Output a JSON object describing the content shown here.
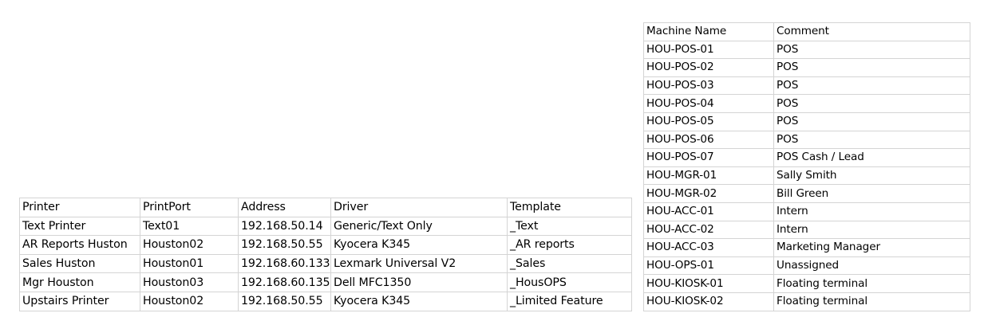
{
  "printers": {
    "headers": [
      "Printer",
      "PrintPort",
      "Address",
      "Driver",
      "Template"
    ],
    "rows": [
      [
        "Text Printer",
        "Text01",
        "192.168.50.14",
        "Generic/Text Only",
        "_Text"
      ],
      [
        "AR Reports Huston",
        "Houston02",
        "192.168.50.55",
        "Kyocera K345",
        "_AR reports"
      ],
      [
        "Sales Huston",
        "Houston01",
        "192.168.60.133",
        "Lexmark Universal V2",
        "_Sales"
      ],
      [
        "Mgr Houston",
        "Houston03",
        "192.168.60.135",
        "Dell MFC1350",
        "_HousOPS"
      ],
      [
        "Upstairs Printer",
        "Houston02",
        "192.168.50.55",
        "Kyocera K345",
        "_Limited Feature"
      ]
    ]
  },
  "machines": {
    "headers": [
      "Machine Name",
      "Comment"
    ],
    "rows": [
      [
        "HOU-POS-01",
        "POS"
      ],
      [
        "HOU-POS-02",
        "POS"
      ],
      [
        "HOU-POS-03",
        "POS"
      ],
      [
        "HOU-POS-04",
        "POS"
      ],
      [
        "HOU-POS-05",
        "POS"
      ],
      [
        "HOU-POS-06",
        "POS"
      ],
      [
        "HOU-POS-07",
        "POS Cash / Lead"
      ],
      [
        "HOU-MGR-01",
        "Sally Smith"
      ],
      [
        "HOU-MGR-02",
        "Bill Green"
      ],
      [
        "HOU-ACC-01",
        "Intern"
      ],
      [
        "HOU-ACC-02",
        "Intern"
      ],
      [
        "HOU-ACC-03",
        "Marketing Manager"
      ],
      [
        "HOU-OPS-01",
        "Unassigned"
      ],
      [
        "HOU-KIOSK-01",
        "Floating terminal"
      ],
      [
        "HOU-KIOSK-02",
        "Floating terminal"
      ]
    ]
  }
}
